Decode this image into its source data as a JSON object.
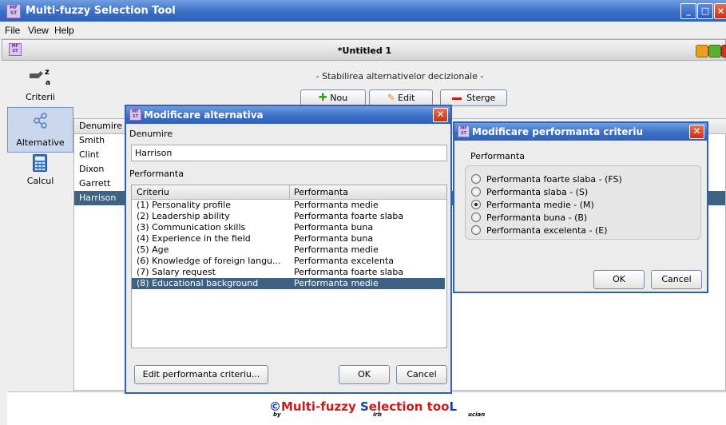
{
  "app": {
    "title": "Multi-fuzzy Selection Tool",
    "icon_text": "MF ST"
  },
  "menu": [
    "File",
    "View",
    "Help"
  ],
  "document": {
    "title": "*Untitled 1"
  },
  "nav": [
    {
      "label": "Criterii",
      "icon": "criteria-icon"
    },
    {
      "label": "Alternative",
      "icon": "share-nodes-icon",
      "selected": true
    },
    {
      "label": "Calcul",
      "icon": "calculator-icon"
    }
  ],
  "main": {
    "heading": "- Stabilirea alternativelor decizionale -",
    "buttons": {
      "new": "Nou",
      "edit": "Edit",
      "delete": "Sterge"
    },
    "column": "Denumire",
    "rows": [
      "Smith",
      "Clint",
      "Dixon",
      "Garrett",
      "Harrison"
    ],
    "selected_row": "Harrison"
  },
  "dialog_alt": {
    "title": "Modificare alternativa",
    "name_label": "Denumire",
    "name_value": "Harrison",
    "perf_label": "Performanta",
    "columns": [
      "Criteriu",
      "Performanta"
    ],
    "rows": [
      {
        "criteriu": "(1) Personality profile",
        "performanta": "Performanta medie"
      },
      {
        "criteriu": "(2) Leadership ability",
        "performanta": "Performanta foarte slaba"
      },
      {
        "criteriu": "(3) Communication skills",
        "performanta": "Performanta buna"
      },
      {
        "criteriu": "(4) Experience in the field",
        "performanta": "Performanta buna"
      },
      {
        "criteriu": "(5) Age",
        "performanta": "Performanta medie"
      },
      {
        "criteriu": "(6) Knowledge of foreign langu...",
        "performanta": "Performanta excelenta"
      },
      {
        "criteriu": "(7) Salary request",
        "performanta": "Performanta foarte slaba"
      },
      {
        "criteriu": "(8) Educational background",
        "performanta": "Performanta medie"
      }
    ],
    "selected_index": 7,
    "edit_button": "Edit performanta criteriu...",
    "ok": "OK",
    "cancel": "Cancel"
  },
  "dialog_perf": {
    "title": "Modificare performanta criteriu",
    "group_label": "Performanta",
    "options": [
      "Performanta foarte slaba - (FS)",
      "Performanta slaba - (S)",
      "Performanta medie - (M)",
      "Performanta buna - (B)",
      "Performanta excelenta - (E)"
    ],
    "selected": 2,
    "ok": "OK",
    "cancel": "Cancel"
  },
  "footer": {
    "copyright": "©",
    "brand_parts": [
      "Multi-fuzzy ",
      "S",
      "election too",
      "L"
    ],
    "sub": [
      "by",
      "irb",
      "ucian"
    ]
  },
  "colors": {
    "title_blue": "#2f61b8",
    "selection": "#3d6284",
    "brand_red": "#d01818",
    "brand_blue": "#1a3ca8"
  }
}
